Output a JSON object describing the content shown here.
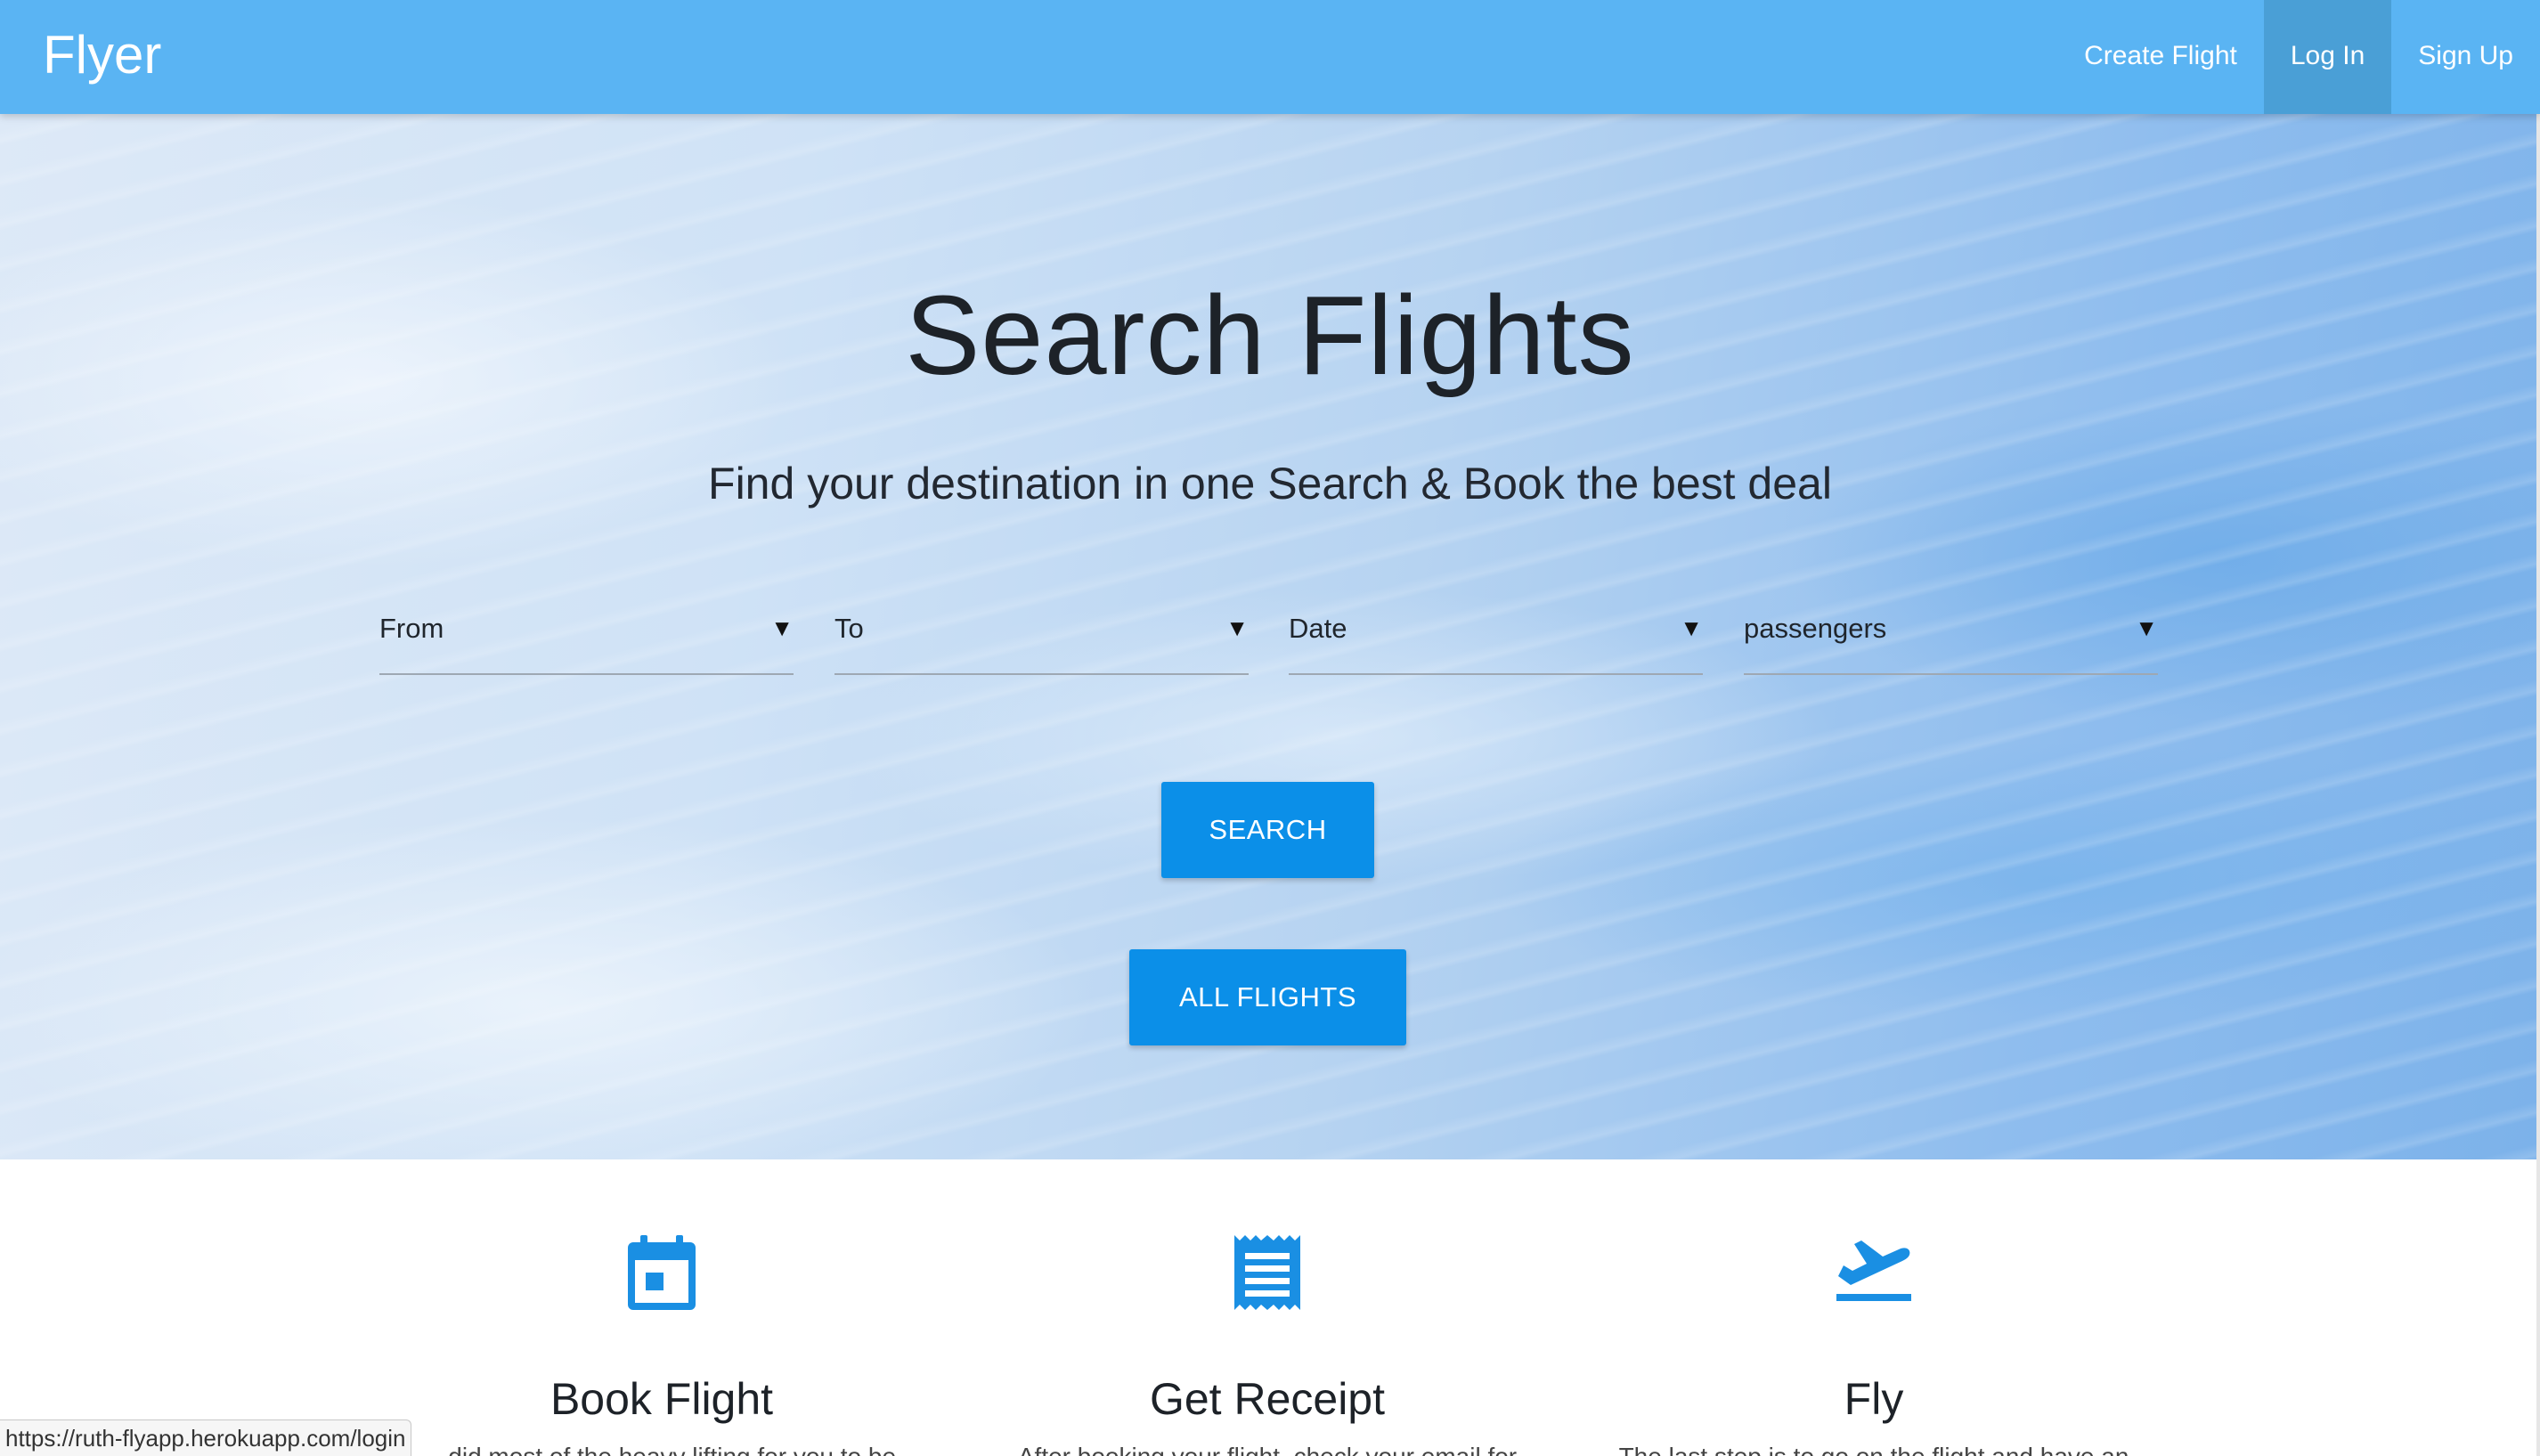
{
  "navbar": {
    "brand": "Flyer",
    "links": [
      {
        "label": "Create Flight",
        "active": false
      },
      {
        "label": "Log In",
        "active": true
      },
      {
        "label": "Sign Up",
        "active": false
      }
    ]
  },
  "hero": {
    "title": "Search Flights",
    "subtitle": "Find your destination in one Search & Book the best deal",
    "fields": [
      {
        "label": "From",
        "arrow": "▼"
      },
      {
        "label": "To",
        "arrow": "▼"
      },
      {
        "label": "Date",
        "arrow": "▼"
      },
      {
        "label": "passengers",
        "arrow": "▼"
      }
    ],
    "search_button": "SEARCH",
    "all_flights_button": "ALL FLIGHTS"
  },
  "features": [
    {
      "icon": "calendar-icon",
      "title": "Book Flight",
      "text": "...did most of the heavy lifting for you to be"
    },
    {
      "icon": "receipt-icon",
      "title": "Get Receipt",
      "text": "After booking your flight, check your email for"
    },
    {
      "icon": "flight-takeoff-icon",
      "title": "Fly",
      "text": "The last step is to go on the flight and have an"
    }
  ],
  "status_bar": {
    "url": "https://ruth-flyapp.herokuapp.com/login"
  },
  "colors": {
    "navbar": "#5ab4f3",
    "nav_active": "#4a9fd6",
    "button": "#0b8fe8",
    "icon": "#1a8fe3"
  }
}
